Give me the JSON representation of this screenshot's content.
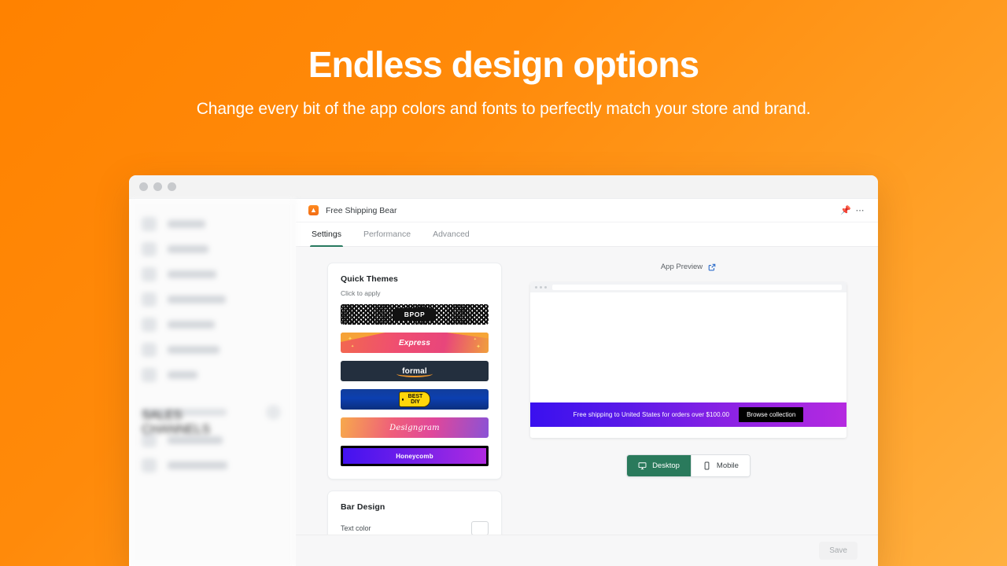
{
  "hero": {
    "title": "Endless design options",
    "subtitle": "Change every bit of the app colors and fonts to perfectly match your store and brand."
  },
  "window": {
    "app_title": "Free Shipping Bear",
    "app_icon": "bear-icon",
    "pin_icon": "pin-icon",
    "more_icon": "more-options-icon",
    "traffic_lights": [
      "close",
      "minimize",
      "maximize"
    ]
  },
  "sidebar": {
    "items": [
      {
        "label": "Home",
        "icon": "home-icon"
      },
      {
        "label": "Orders",
        "icon": "orders-icon"
      },
      {
        "label": "Products",
        "icon": "products-icon"
      },
      {
        "label": "Customers",
        "icon": "customers-icon"
      },
      {
        "label": "Analytics",
        "icon": "analytics-icon"
      },
      {
        "label": "Discounts",
        "icon": "discounts-icon"
      },
      {
        "label": "Apps",
        "icon": "apps-icon"
      }
    ],
    "section_label": "SALES CHANNELS",
    "channels": [
      {
        "label": "Online store",
        "icon": "online-store-icon"
      },
      {
        "label": "Point of sale",
        "icon": "point-of-sale-icon"
      }
    ]
  },
  "tabs": [
    {
      "label": "Settings",
      "active": true
    },
    {
      "label": "Performance",
      "active": false
    },
    {
      "label": "Advanced",
      "active": false
    }
  ],
  "quick_themes": {
    "title": "Quick Themes",
    "subtitle": "Click to apply",
    "items": [
      {
        "name": "BPOP",
        "style": "qr"
      },
      {
        "name": "Express",
        "style": "gradient-pink"
      },
      {
        "name": "formal",
        "style": "dark-navy"
      },
      {
        "name": "BEST\nDIY",
        "style": "blue-tag",
        "line1": "BEST",
        "line2": "DIY"
      },
      {
        "name": "Designgram",
        "style": "instagram-gradient"
      },
      {
        "name": "Honeycomb",
        "style": "purple-on-black"
      }
    ]
  },
  "bar_design": {
    "title": "Bar Design",
    "text_color_label": "Text color"
  },
  "preview": {
    "title": "App Preview",
    "external_link_icon": "external-link-icon",
    "announcement_text": "Free shipping to United States for orders over $100.00",
    "cta_label": "Browse collection",
    "devices": [
      {
        "label": "Desktop",
        "icon": "monitor-icon",
        "active": true
      },
      {
        "label": "Mobile",
        "icon": "phone-icon",
        "active": false
      }
    ]
  },
  "footer": {
    "save_label": "Save"
  },
  "colors": {
    "background_start": "#FF8200",
    "background_end": "#FFB040",
    "accent_green": "#2a7a5c",
    "link_blue": "#2f6ecb",
    "bar_gradient_start": "#3a10ef",
    "bar_gradient_end": "#b52ae0"
  }
}
